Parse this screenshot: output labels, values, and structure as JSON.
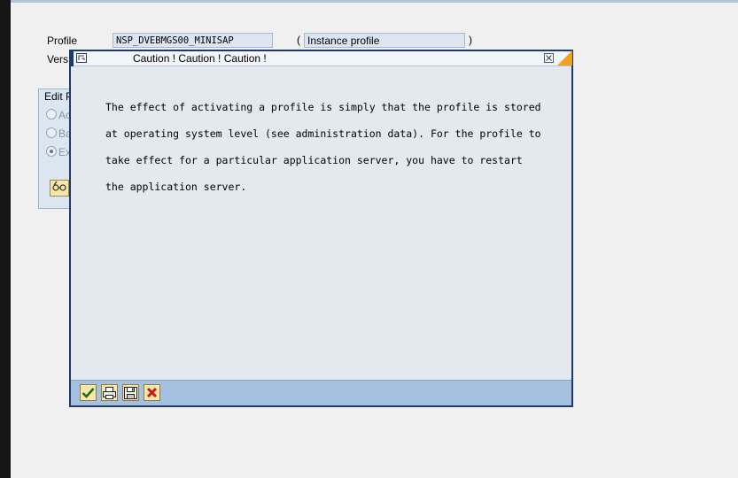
{
  "background": {
    "profile_label": "Profile",
    "profile_value": "NSP_DVEBMGS00_MINISAP",
    "paren_open": "(",
    "profile_type": "Instance profile",
    "paren_close": ")",
    "version_label": "Vers",
    "group_title": "Edit P",
    "radio_1": "Ac",
    "radio_2": "Ba",
    "radio_3": "Ex"
  },
  "dialog": {
    "title": "Caution !  Caution !  Caution !",
    "message_lines": [
      "The effect of activating a profile is simply that the profile is stored",
      "at operating system level (see administration data). For the profile to",
      "take effect for a particular application server, you have to restart",
      "the application server."
    ]
  },
  "footer_buttons": [
    "checkmark-icon",
    "print-icon",
    "save-icon",
    "cancel-icon"
  ],
  "colors": {
    "accent": "#f0a020",
    "dialog_border": "#1e3a66",
    "footer_bg": "#a6c0e0",
    "button_bg": "#f6e6a8"
  }
}
